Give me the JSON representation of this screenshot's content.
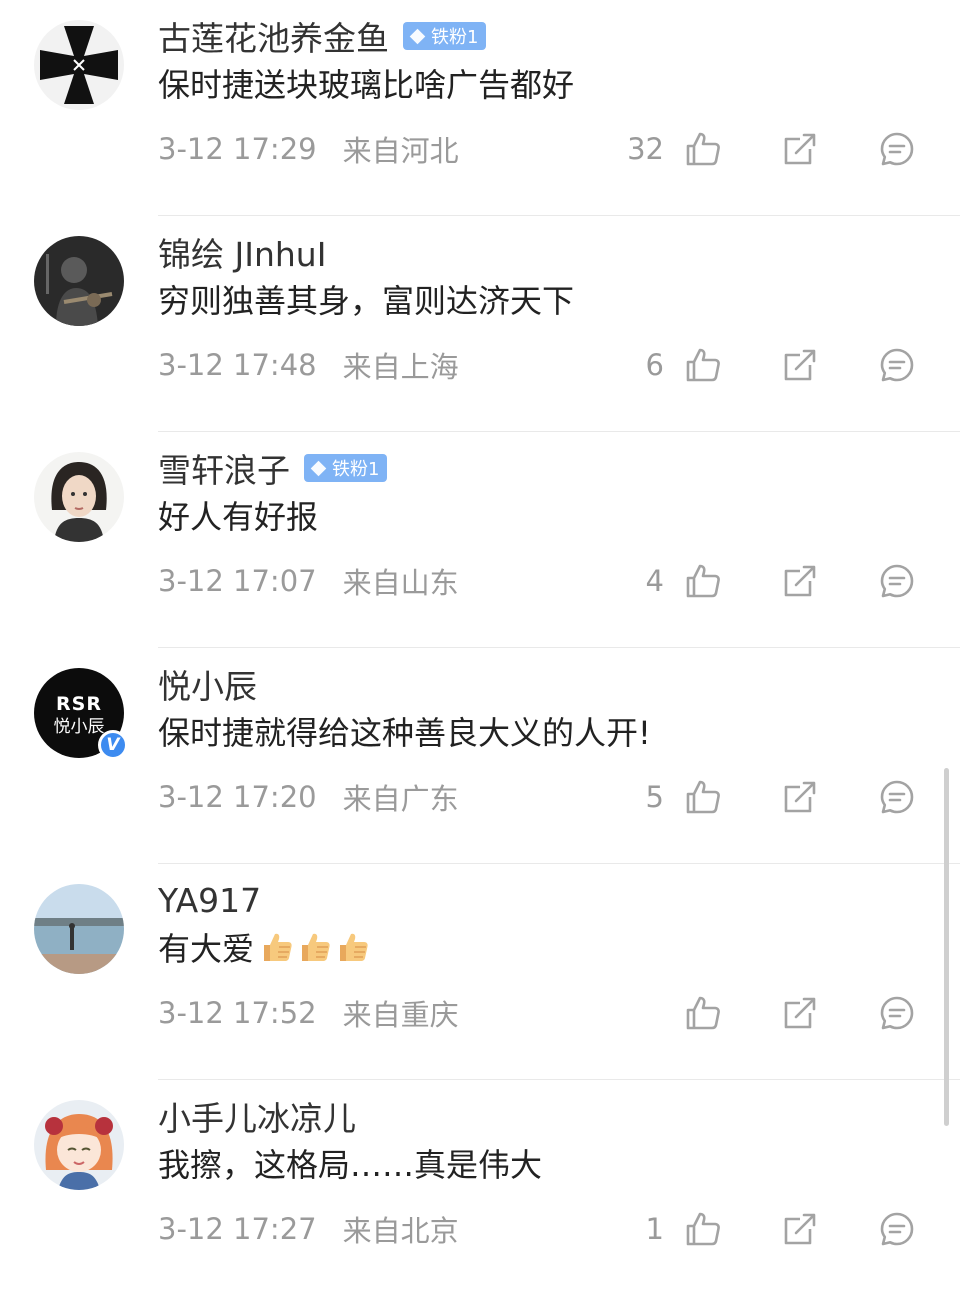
{
  "comments": [
    {
      "username": "古莲花池养金鱼",
      "badge": "铁粉1",
      "text": "保时捷送块玻璃比啥广告都好",
      "time": "3-12 17:29",
      "location": "来自河北",
      "likes": "32",
      "avatar_icon": "iron-cross-avatar"
    },
    {
      "username": "锦绘 JInhuI",
      "text": "穷则独善其身，富则达济天下",
      "time": "3-12 17:48",
      "location": "来自上海",
      "likes": "6",
      "avatar_icon": "guitarist-avatar"
    },
    {
      "username": "雪轩浪子",
      "badge": "铁粉1",
      "text": "好人有好报",
      "time": "3-12 17:07",
      "location": "来自山东",
      "likes": "4",
      "avatar_icon": "woman-portrait-avatar"
    },
    {
      "username": "悦小辰",
      "text": "保时捷就得给这种善良大义的人开!",
      "time": "3-12 17:20",
      "location": "来自广东",
      "likes": "5",
      "avatar_icon": "rsr-logo-avatar",
      "avatar_text_top": "RSR",
      "avatar_text_bottom": "悦小辰",
      "verified_mark": "V"
    },
    {
      "username": "YA917",
      "text": "有大爱",
      "emojis": [
        "thumbs-up-emoji",
        "thumbs-up-emoji",
        "thumbs-up-emoji"
      ],
      "time": "3-12 17:52",
      "location": "来自重庆",
      "likes": "",
      "avatar_icon": "lake-landscape-avatar"
    },
    {
      "username": "小手儿冰凉儿",
      "text": "我擦，这格局……真是伟大",
      "time": "3-12 17:27",
      "location": "来自北京",
      "likes": "1",
      "avatar_icon": "anime-girl-avatar"
    }
  ],
  "action_icons": [
    "like-icon",
    "share-icon",
    "reply-icon"
  ],
  "colors": {
    "badge_bg": "#7fb3f5",
    "verified_blue": "#3d8bf0",
    "meta_gray": "#9a9a9a",
    "icon_gray": "#a3a3a3"
  }
}
